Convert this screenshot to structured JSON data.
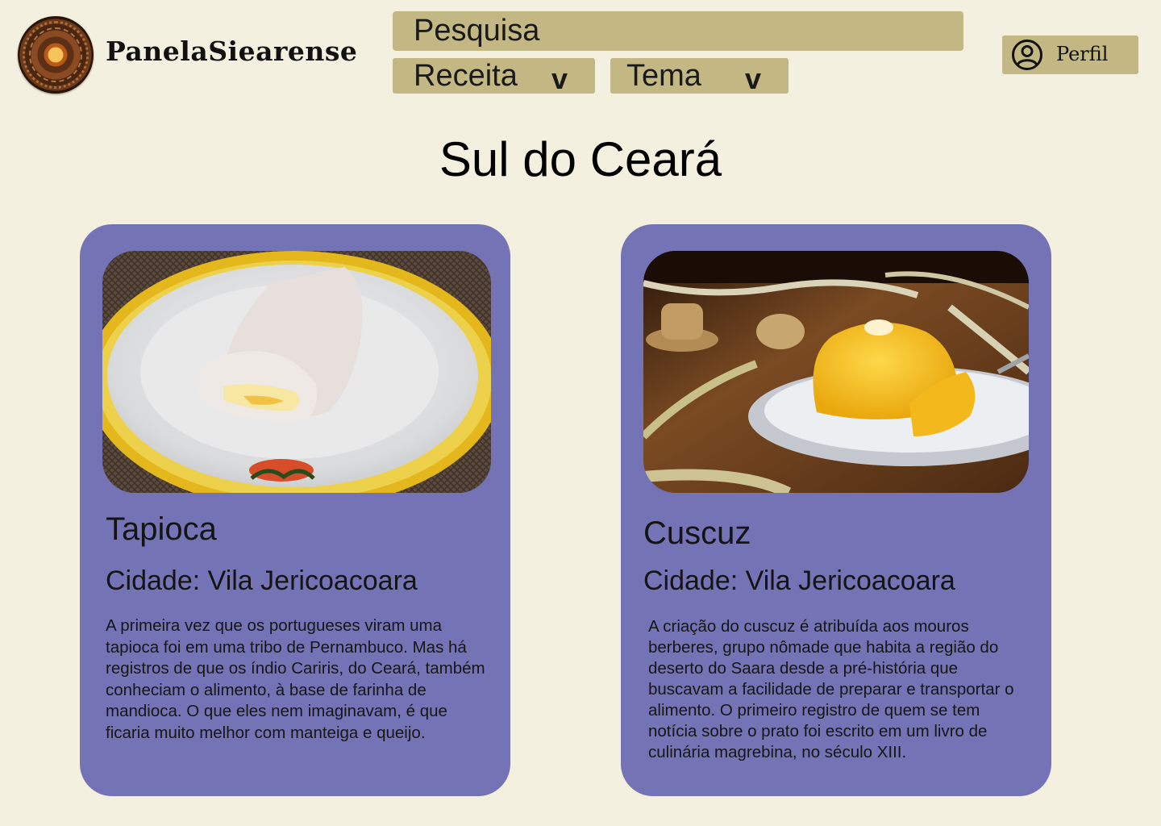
{
  "header": {
    "brand": "PanelaSiearense",
    "search_label": "Pesquisa",
    "filters": [
      {
        "label": "Receita",
        "chevron": "v"
      },
      {
        "label": "Tema",
        "chevron": "v"
      }
    ],
    "profile_label": "Perfil"
  },
  "page": {
    "heading": "Sul do Ceará"
  },
  "cards": [
    {
      "title": "Tapioca",
      "city": "Cidade: Vila Jericoacoara",
      "description": "A primeira vez que os portugueses viram uma tapioca foi em uma tribo de Pernambuco. Mas há registros de que os índio Cariris, do Ceará, também conheciam o alimento, à base de farinha de mandioca. O que eles nem imaginavam, é que ficaria muito melhor com manteiga e queijo."
    },
    {
      "title": "Cuscuz",
      "city": "Cidade: Vila Jericoacoara",
      "description": "A criação do cuscuz é atribuída aos mouros berberes, grupo nômade que habita a região do deserto do Saara desde a pré-história que buscavam a facilidade de preparar e transportar o alimento. O primeiro registro de quem se tem notícia sobre o prato foi escrito em um livro de culinária magrebina, no século XIII."
    }
  ],
  "colors": {
    "background": "#f4f0df",
    "control": "#c3b784",
    "card": "#7373b6"
  },
  "icons": {
    "logo": "panela-logo",
    "profile": "user-circle-icon",
    "dropdown": "chevron-down-icon"
  }
}
